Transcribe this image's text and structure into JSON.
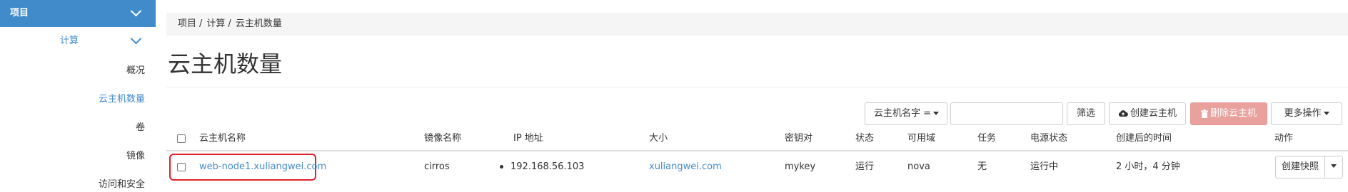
{
  "sidebar": {
    "project_label": "项目",
    "compute_label": "计算",
    "items": [
      {
        "label": "概况"
      },
      {
        "label": "云主机数量"
      },
      {
        "label": "卷"
      },
      {
        "label": "镜像"
      },
      {
        "label": "访问和安全"
      }
    ]
  },
  "breadcrumb": [
    "项目",
    "计算",
    "云主机数量"
  ],
  "breadcrumb_sep": "/",
  "page_title": "云主机数量",
  "toolbar": {
    "filter_field": "云主机名字 =",
    "filter_value": "",
    "filter_button": "筛选",
    "create_button": "创建云主机",
    "delete_button": "删除云主机",
    "more_button": "更多操作"
  },
  "table": {
    "headers": [
      "云主机名称",
      "镜像名称",
      "IP 地址",
      "大小",
      "密钥对",
      "状态",
      "可用域",
      "任务",
      "电源状态",
      "创建后的时间",
      "动作"
    ],
    "rows": [
      {
        "name": "web-node1.xuliangwei.com",
        "image": "cirros",
        "ip": "192.168.56.103",
        "size": "xuliangwei.com",
        "keypair": "mykey",
        "status": "运行",
        "zone": "nova",
        "task": "无",
        "power": "运行中",
        "age": "2 小时，4 分钟",
        "action": "创建快照"
      }
    ]
  },
  "colors": {
    "primary": "#428bca",
    "danger_disabled": "#e9a19e",
    "highlight_border": "#e0202a"
  }
}
